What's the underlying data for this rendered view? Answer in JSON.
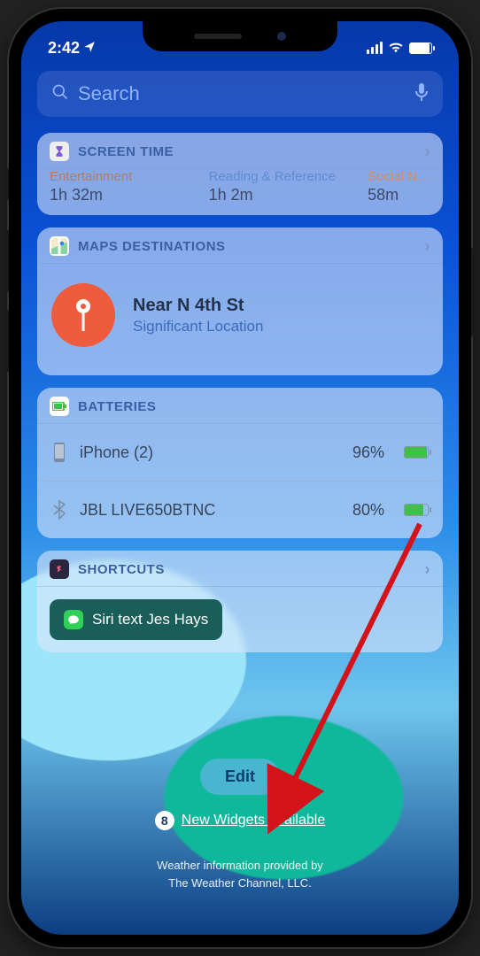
{
  "status": {
    "time": "2:42",
    "location_icon": "location-arrow"
  },
  "search": {
    "placeholder": "Search"
  },
  "widgets": {
    "screen_time": {
      "title": "SCREEN TIME",
      "cols": [
        {
          "category": "Entertainment",
          "value": "1h 32m"
        },
        {
          "category": "Reading & Reference",
          "value": "1h 2m"
        },
        {
          "category": "Social N…",
          "value": "58m"
        }
      ]
    },
    "maps": {
      "title": "MAPS DESTINATIONS",
      "location": {
        "title": "Near N 4th St",
        "subtitle": "Significant Location"
      }
    },
    "batteries": {
      "title": "BATTERIES",
      "devices": [
        {
          "name": "iPhone (2)",
          "percent": "96%",
          "fill": 96,
          "icon": "iphone"
        },
        {
          "name": "JBL LIVE650BTNC",
          "percent": "80%",
          "fill": 80,
          "icon": "bluetooth"
        }
      ]
    },
    "shortcuts": {
      "title": "SHORTCUTS",
      "button": "Siri text Jes Hays"
    }
  },
  "footer": {
    "edit": "Edit",
    "new_widgets_count": "8",
    "new_widgets_label": "New Widgets Available",
    "credit_line1": "Weather information provided by",
    "credit_line2": "The Weather Channel, LLC."
  }
}
